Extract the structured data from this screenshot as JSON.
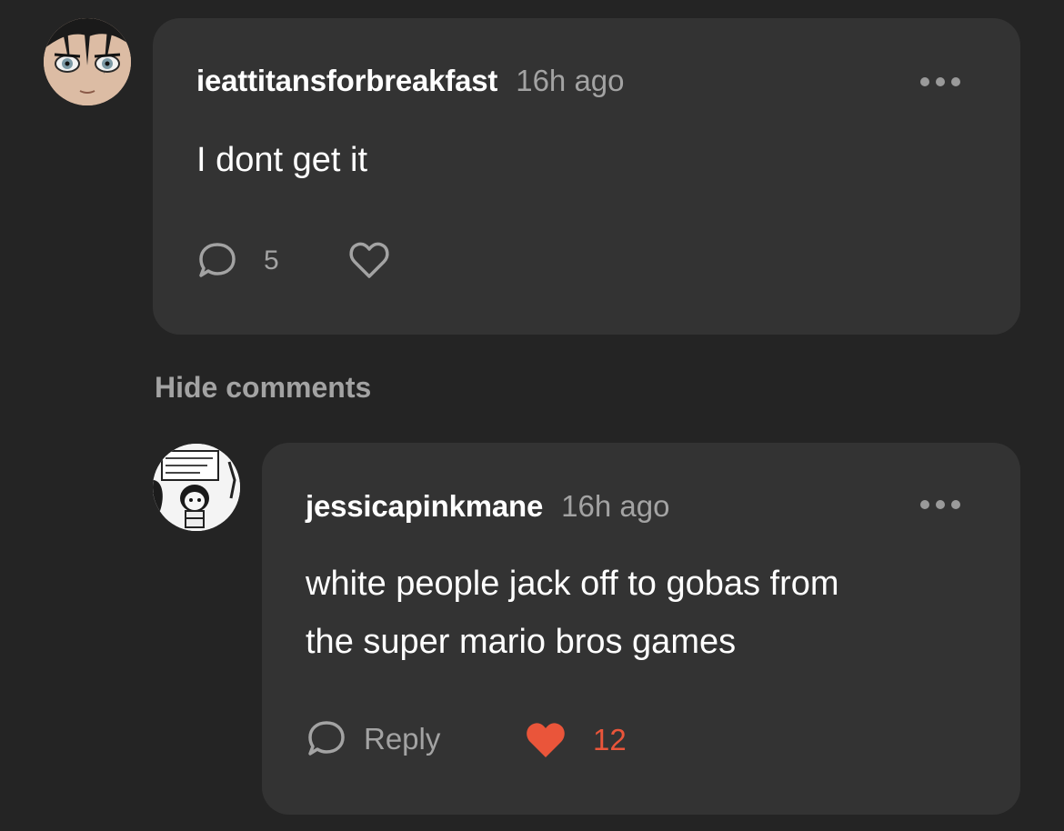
{
  "comments": [
    {
      "username": "ieattitansforbreakfast",
      "timestamp": "16h ago",
      "text": "I dont get it",
      "reply_count": "5",
      "liked": false
    },
    {
      "username": "jessicapinkmane",
      "timestamp": "16h ago",
      "text_lines": [
        "white people jack off to gobas from",
        "the super mario bros games"
      ],
      "reply_label": "Reply",
      "like_count": "12",
      "liked": true
    }
  ],
  "hide_comments_label": "Hide comments",
  "colors": {
    "background": "#242424",
    "card": "#333333",
    "muted_text": "#a3a3a3",
    "like_red": "#ea553a"
  }
}
